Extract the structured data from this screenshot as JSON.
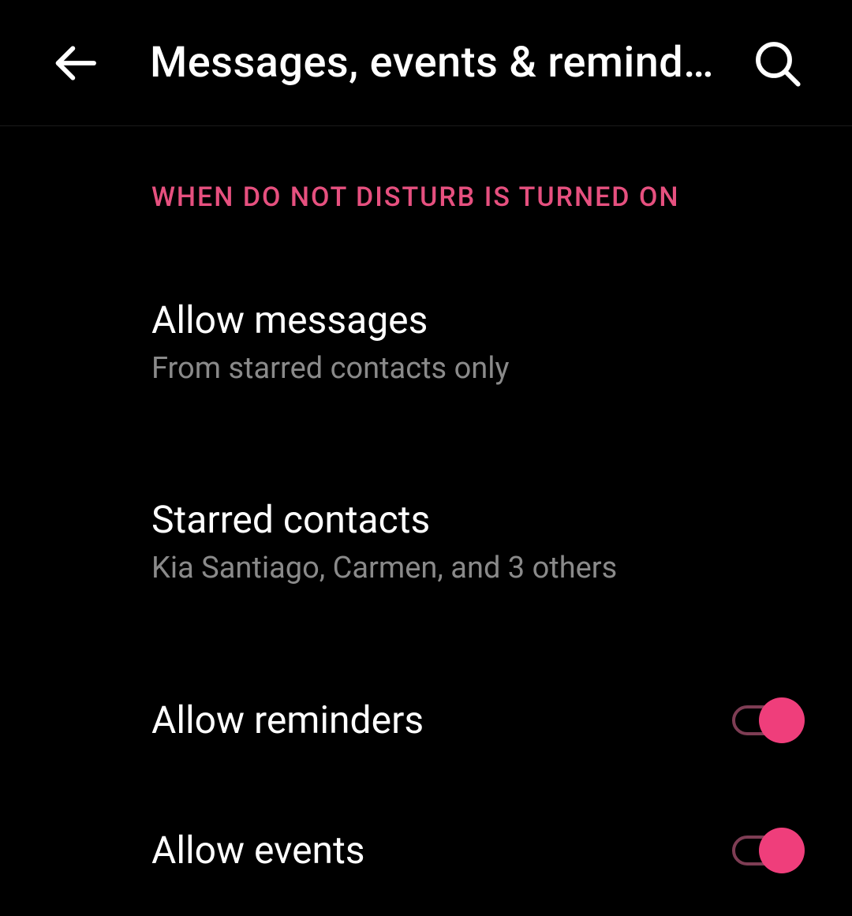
{
  "header": {
    "title": "Messages, events & reminders"
  },
  "section": {
    "heading": "WHEN DO NOT DISTURB IS TURNED ON"
  },
  "settings": {
    "allowMessages": {
      "title": "Allow messages",
      "subtitle": "From starred contacts only"
    },
    "starredContacts": {
      "title": "Starred contacts",
      "subtitle": "Kia Santiago, Carmen, and 3 others"
    },
    "allowReminders": {
      "title": "Allow reminders",
      "on": true
    },
    "allowEvents": {
      "title": "Allow events",
      "on": true
    }
  },
  "colors": {
    "accent": "#e6507f",
    "toggleThumb": "#ef3e7b",
    "toggleTrack": "#7e3d54",
    "subtitle": "#8a8a8a"
  }
}
